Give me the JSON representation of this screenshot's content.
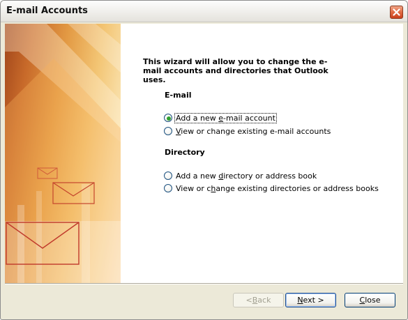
{
  "window": {
    "title": "E-mail Accounts"
  },
  "intro": "This wizard will allow you to change the e-mail accounts and directories that Outlook uses.",
  "email_section": {
    "heading": "E-mail",
    "options": [
      {
        "pre": "Add a new ",
        "key": "e",
        "post": "-mail account",
        "selected": true
      },
      {
        "pre": "",
        "key": "V",
        "post": "iew or change existing e-mail accounts",
        "selected": false
      }
    ]
  },
  "directory_section": {
    "heading": "Directory",
    "options": [
      {
        "pre": "Add a new ",
        "key": "d",
        "post": "irectory or address book",
        "selected": false
      },
      {
        "pre": "View or c",
        "key": "h",
        "post": "ange existing directories or address books",
        "selected": false
      }
    ]
  },
  "buttons": {
    "back": {
      "pre": "< ",
      "key": "B",
      "post": "ack",
      "enabled": false
    },
    "next": {
      "pre": "",
      "key": "N",
      "post": "ext >",
      "enabled": true
    },
    "close": {
      "pre": "",
      "key": "C",
      "post": "lose",
      "enabled": true
    }
  },
  "icons": [
    "close-icon",
    "envelope-icon"
  ],
  "colors": {
    "radio_selected": "#2fa02f",
    "art_orange": "#e39a44",
    "close_button": "#e06a42"
  }
}
